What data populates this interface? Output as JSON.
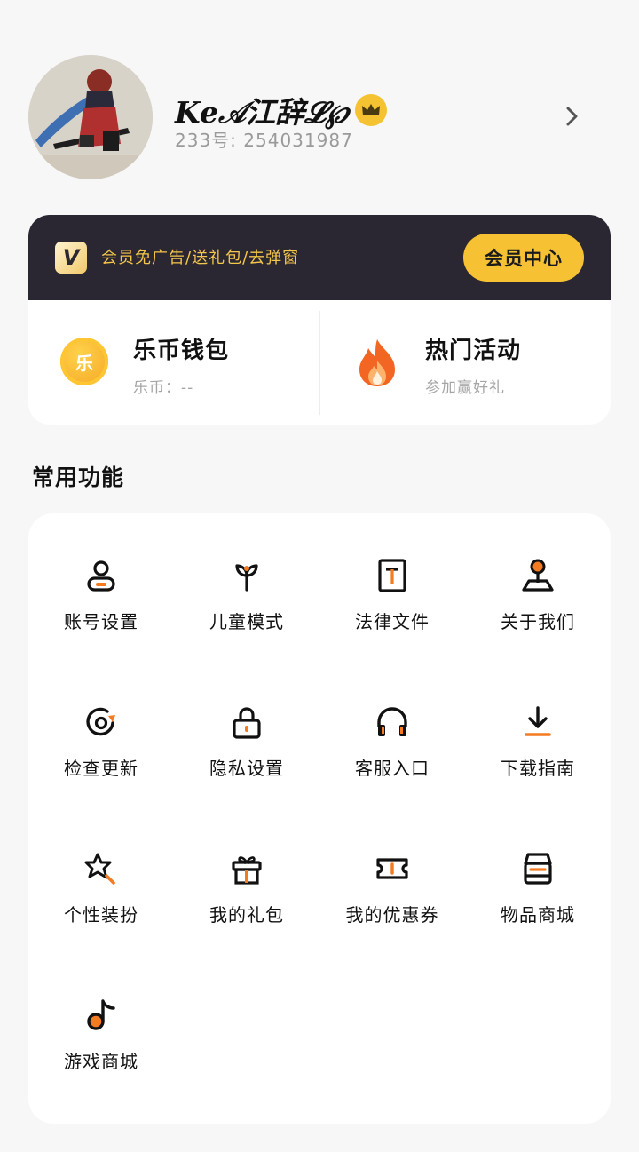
{
  "profile": {
    "nickname": "Ke𝒜江辞𝓛℘",
    "uid": "233号: 254031987"
  },
  "vip": {
    "logo_letter": "V",
    "promo": "会员免广告/送礼包/去弹窗",
    "button": "会员中心"
  },
  "wallet": {
    "coin_char": "乐",
    "title": "乐币钱包",
    "subtitle": "乐币：--"
  },
  "activity": {
    "title": "热门活动",
    "subtitle": "参加赢好礼"
  },
  "common": {
    "title": "常用功能",
    "items": [
      {
        "label": "账号设置",
        "icon": "user-icon"
      },
      {
        "label": "儿童模式",
        "icon": "sprout-icon"
      },
      {
        "label": "法律文件",
        "icon": "document-icon"
      },
      {
        "label": "关于我们",
        "icon": "joystick-icon"
      },
      {
        "label": "检查更新",
        "icon": "refresh-icon"
      },
      {
        "label": "隐私设置",
        "icon": "lock-icon"
      },
      {
        "label": "客服入口",
        "icon": "headset-icon"
      },
      {
        "label": "下载指南",
        "icon": "download-icon"
      },
      {
        "label": "个性装扮",
        "icon": "star-wand-icon"
      },
      {
        "label": "我的礼包",
        "icon": "gift-icon"
      },
      {
        "label": "我的优惠券",
        "icon": "ticket-icon"
      },
      {
        "label": "物品商城",
        "icon": "store-icon"
      },
      {
        "label": "游戏商城",
        "icon": "music-note-icon"
      }
    ]
  },
  "colors": {
    "accent": "#f6c233",
    "orange": "#f47b20",
    "vip_bar": "#2a2733",
    "background": "#f7f7f7"
  }
}
